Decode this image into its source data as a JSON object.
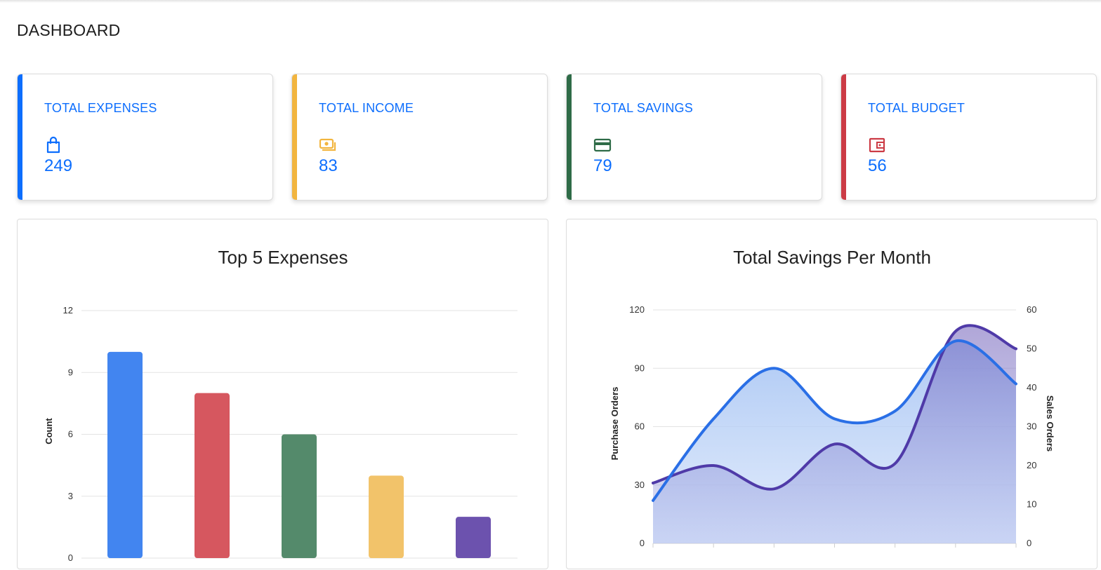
{
  "page": {
    "title": "DASHBOARD"
  },
  "cards": [
    {
      "label": "TOTAL EXPENSES",
      "value": "249",
      "icon": "shopping-bag-icon",
      "accent": "#0d6efd",
      "icon_color": "#0d6efd"
    },
    {
      "label": "TOTAL INCOME",
      "value": "83",
      "icon": "cash-stack-icon",
      "accent": "#f2b53f",
      "icon_color": "#f2b53f"
    },
    {
      "label": "TOTAL SAVINGS",
      "value": "79",
      "icon": "credit-card-icon",
      "accent": "#2e6b47",
      "icon_color": "#2e6b47"
    },
    {
      "label": "TOTAL BUDGET",
      "value": "56",
      "icon": "wallet-icon",
      "accent": "#cc3b45",
      "icon_color": "#cc3b45"
    }
  ],
  "chart_data": [
    {
      "type": "bar",
      "title": "Top 5 Expenses",
      "ylabel": "Count",
      "xlabel": "",
      "ylim": [
        0,
        12
      ],
      "yticks": [
        "0",
        "3",
        "6",
        "9",
        "12"
      ],
      "values": [
        10,
        8,
        6,
        4,
        2
      ],
      "colors": [
        "#4285f0",
        "#d6575f",
        "#548a6b",
        "#f2c36a",
        "#6c52ae"
      ],
      "grid": true
    },
    {
      "type": "area",
      "title": "Total Savings Per Month",
      "ylabel": "Purchase Orders",
      "y2label": "Sales Orders",
      "ylim": [
        0,
        120
      ],
      "y2lim": [
        0,
        60
      ],
      "yticks": [
        "0",
        "30",
        "60",
        "90",
        "120"
      ],
      "y2ticks": [
        "0",
        "10",
        "20",
        "30",
        "40",
        "50",
        "60"
      ],
      "grid": true,
      "series": [
        {
          "values": [
            11,
            32,
            45,
            32,
            34,
            52,
            41
          ],
          "axis": "y2",
          "color": "#2a6fe6"
        },
        {
          "values": [
            31,
            40,
            28,
            51,
            41,
            109,
            100
          ],
          "axis": "y",
          "color": "#4f3aa8"
        }
      ]
    }
  ]
}
